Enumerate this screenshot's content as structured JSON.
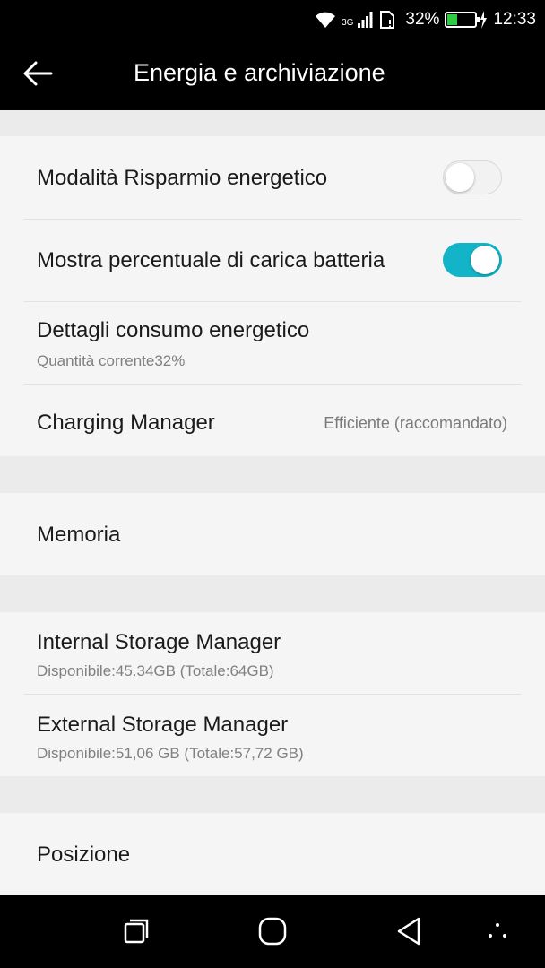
{
  "status_bar": {
    "network_type": "3G",
    "battery_percent": "32%",
    "time": "12:33",
    "icons": [
      "wifi-icon",
      "signal-icon",
      "sim-notification-icon",
      "battery-charging-icon"
    ]
  },
  "app_bar": {
    "title": "Energia e archiviazione",
    "back_icon": "arrow-left-icon"
  },
  "power": {
    "power_saving": {
      "title": "Modalità Risparmio energetico",
      "enabled": false
    },
    "battery_percentage": {
      "title": "Mostra percentuale di carica batteria",
      "enabled": true
    },
    "consumption": {
      "title": "Dettagli consumo energetico",
      "subtitle": "Quantità corrente32%"
    },
    "charging": {
      "title": "Charging Manager",
      "value": "Efficiente (raccomandato)"
    }
  },
  "memory": {
    "title": "Memoria"
  },
  "storage": {
    "internal": {
      "title": "Internal Storage Manager",
      "subtitle": "Disponibile:45.34GB (Totale:64GB)"
    },
    "external": {
      "title": "External Storage Manager",
      "subtitle": "Disponibile:51,06 GB (Totale:57,72 GB)"
    }
  },
  "location": {
    "title": "Posizione"
  },
  "nav_bar": {
    "icons": [
      "recent-apps-icon",
      "home-icon",
      "back-icon",
      "nav-menu-icon"
    ]
  },
  "colors": {
    "toggle_on": "#14b4c8",
    "background": "#ebebeb",
    "section": "#f5f5f5",
    "bars": "#000000"
  }
}
